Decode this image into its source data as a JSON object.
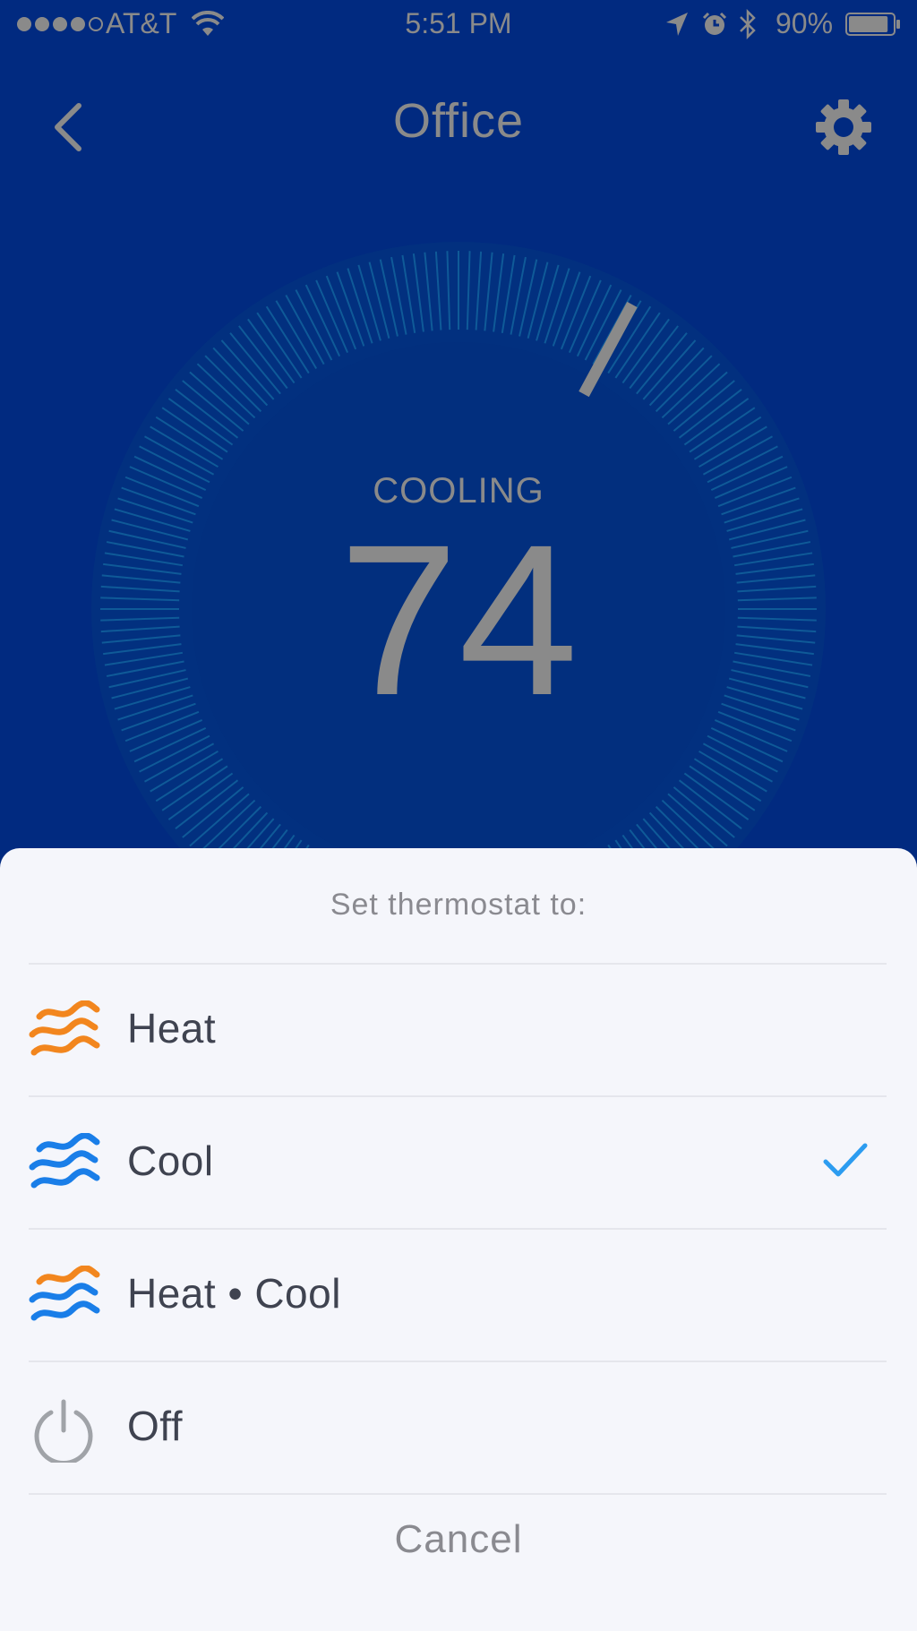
{
  "status_bar": {
    "carrier": "AT&T",
    "time": "5:51 PM",
    "battery": "90%",
    "signal_bars_filled": 4,
    "signal_bars_total": 5,
    "battery_level": 0.9,
    "icons": [
      "signal-dots-icon",
      "wifi-icon",
      "location-arrow-icon",
      "alarm-clock-icon",
      "bluetooth-icon",
      "battery-icon"
    ]
  },
  "nav": {
    "title": "Office",
    "back_icon": "chevron-left-icon",
    "settings_icon": "gear-icon"
  },
  "thermostat": {
    "mode": "COOLING",
    "temperature": "74"
  },
  "sheet": {
    "title": "Set thermostat to:",
    "options": [
      {
        "label": "Heat",
        "icon": "heat-waves-icon",
        "selected": false
      },
      {
        "label": "Cool",
        "icon": "cool-waves-icon",
        "selected": true
      },
      {
        "label": "Heat • Cool",
        "icon": "heat-cool-waves-icon",
        "selected": false
      },
      {
        "label": "Off",
        "icon": "power-icon",
        "selected": false
      }
    ],
    "cancel": "Cancel"
  },
  "colors": {
    "background": "#012a80",
    "dim_text": "#8a8a8a",
    "tick": "#0f5a98",
    "sheet_bg": "#f5f6fb",
    "heat": "#f2861e",
    "cool": "#1a7ee8",
    "check": "#2c9cf0",
    "option_text": "#3f4350"
  }
}
